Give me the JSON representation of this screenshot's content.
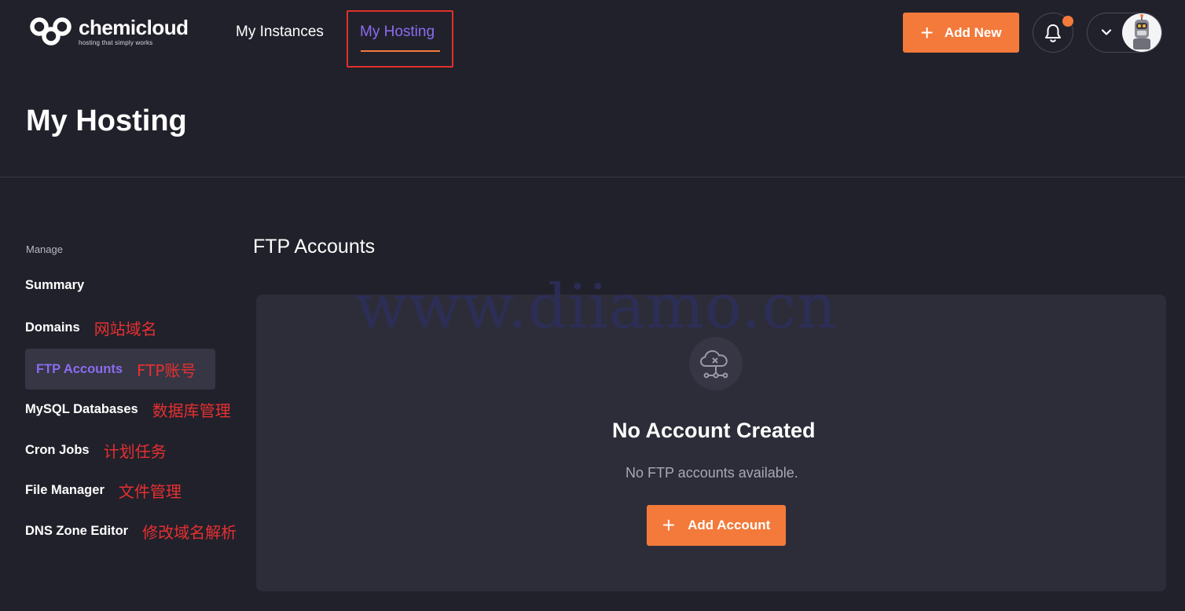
{
  "brand": {
    "name": "chemicloud",
    "tagline": "hosting that simply works"
  },
  "nav": {
    "instances": "My Instances",
    "hosting": "My Hosting"
  },
  "header": {
    "add_new_label": "Add New",
    "plus_icon": "plus-icon",
    "bell_icon": "bell-icon",
    "chevron_icon": "chevron-down-icon"
  },
  "page": {
    "title": "My Hosting"
  },
  "sidebar": {
    "heading": "Manage",
    "items": [
      {
        "label": "Summary",
        "note": ""
      },
      {
        "label": "Domains",
        "note": "网站域名"
      },
      {
        "label": "FTP Accounts",
        "note": "FTP账号"
      },
      {
        "label": "MySQL Databases",
        "note": "数据库管理"
      },
      {
        "label": "Cron Jobs",
        "note": "计划任务"
      },
      {
        "label": "File Manager",
        "note": "文件管理"
      },
      {
        "label": "DNS Zone Editor",
        "note": "修改域名解析"
      }
    ]
  },
  "main": {
    "section_title": "FTP Accounts",
    "empty_title": "No Account Created",
    "empty_subtitle": "No FTP accounts available.",
    "add_account_label": "Add Account"
  },
  "watermark": "www.diiamo.cn",
  "colors": {
    "accent": "#f37a3a",
    "active": "#8b6cf0",
    "background": "#21212b",
    "card": "#2d2d39",
    "annotation": "#e63030"
  }
}
